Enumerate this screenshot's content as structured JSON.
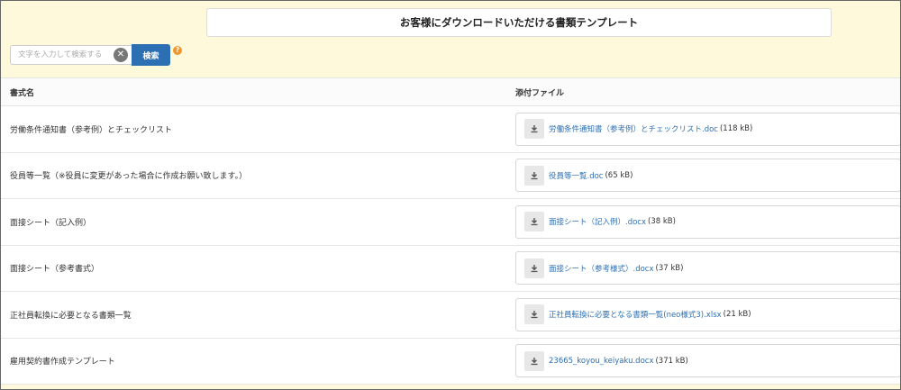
{
  "header": {
    "title": "お客様にダウンロードいただける書類テンプレート"
  },
  "search": {
    "placeholder": "文字を入力して検索する",
    "button_label": "検索",
    "help_symbol": "?"
  },
  "table": {
    "headers": {
      "name": "書式名",
      "file": "添付ファイル"
    },
    "rows": [
      {
        "name": "労働条件通知書（参考例）とチェックリスト",
        "file": "労働条件通知書（参考例）とチェックリスト.doc",
        "size": "(118 kB)"
      },
      {
        "name": "役員等一覧（※役員に変更があった場合に作成お願い致します。）",
        "file": "役員等一覧.doc",
        "size": "(65 kB)"
      },
      {
        "name": "面接シート（記入例）",
        "file": "面接シート（記入例）.docx",
        "size": "(38 kB)"
      },
      {
        "name": "面接シート（参考書式）",
        "file": "面接シート（参考様式）.docx",
        "size": "(37 kB)"
      },
      {
        "name": "正社員転換に必要となる書類一覧",
        "file": "正社員転換に必要となる書類一覧(neo様式3).xlsx",
        "size": "(21 kB)"
      },
      {
        "name": "雇用契約書作成テンプレート",
        "file": "23665_koyou_keiyaku.docx",
        "size": "(371 kB)"
      }
    ]
  },
  "colors": {
    "background": "#fff9dc",
    "accent": "#2d6fb3",
    "help": "#f0962c"
  },
  "icons": {
    "clear": "clear-icon",
    "download": "download-icon",
    "help": "help-icon"
  }
}
